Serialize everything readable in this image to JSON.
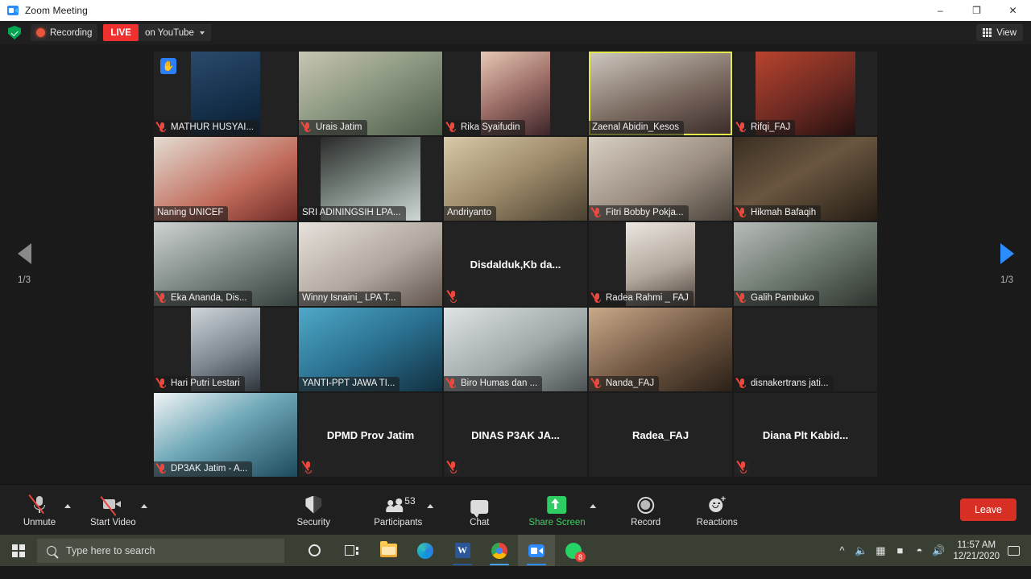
{
  "window": {
    "title": "Zoom Meeting",
    "app_icon": "zoom-icon",
    "minimize": "–",
    "maximize": "❐",
    "close": "✕"
  },
  "topbar": {
    "shield_icon": "shield-encryption-icon",
    "recording_label": "Recording",
    "live_label": "LIVE",
    "stream_label": "on YouTube",
    "stream_caret_icon": "chevron-down-icon",
    "view_label": "View",
    "view_icon": "grid-icon"
  },
  "gallery": {
    "page_left_icon": "chevron-left-icon",
    "page_right_icon": "chevron-right-icon",
    "page_indicator_left": "1/3",
    "page_indicator_right": "1/3",
    "tiles": [
      {
        "name": "MATHUR HUSYAI...",
        "muted": true,
        "video": true,
        "active": false,
        "raise_hand": true,
        "layout": "narrow",
        "label": "bottom"
      },
      {
        "name": "Urais Jatim",
        "muted": true,
        "video": true,
        "active": false,
        "raise_hand": false,
        "layout": "full",
        "label": "bottom"
      },
      {
        "name": "Rika Syaifudin",
        "muted": true,
        "video": true,
        "active": false,
        "raise_hand": false,
        "layout": "narrow",
        "label": "bottom"
      },
      {
        "name": "Zaenal Abidin_Kesos",
        "muted": false,
        "video": true,
        "active": true,
        "raise_hand": false,
        "layout": "full",
        "label": "bottom"
      },
      {
        "name": "Rifqi_FAJ",
        "muted": true,
        "video": true,
        "active": false,
        "raise_hand": false,
        "layout": "mid",
        "label": "bottom"
      },
      {
        "name": "Naning UNICEF",
        "muted": false,
        "video": true,
        "active": false,
        "raise_hand": false,
        "layout": "full",
        "label": "bottom"
      },
      {
        "name": "SRI ADININGSIH LPA...",
        "muted": false,
        "video": true,
        "active": false,
        "raise_hand": false,
        "layout": "mid",
        "label": "bottom"
      },
      {
        "name": "Andriyanto",
        "muted": false,
        "video": true,
        "active": false,
        "raise_hand": false,
        "layout": "full",
        "label": "bottom"
      },
      {
        "name": "Fitri Bobby Pokja...",
        "muted": true,
        "video": true,
        "active": false,
        "raise_hand": false,
        "layout": "full",
        "label": "bottom"
      },
      {
        "name": "Hikmah Bafaqih",
        "muted": true,
        "video": true,
        "active": false,
        "raise_hand": false,
        "layout": "full",
        "label": "bottom"
      },
      {
        "name": "Eka Ananda, Dis...",
        "muted": true,
        "video": true,
        "active": false,
        "raise_hand": false,
        "layout": "full",
        "label": "bottom"
      },
      {
        "name": "Winny Isnaini_ LPA T...",
        "muted": false,
        "video": true,
        "active": false,
        "raise_hand": false,
        "layout": "full",
        "label": "bottom"
      },
      {
        "name": "Disdalduk,Kb  da...",
        "muted": true,
        "video": false,
        "active": false,
        "raise_hand": false,
        "layout": "none",
        "label": "center"
      },
      {
        "name": "Radea Rahmi _ FAJ",
        "muted": true,
        "video": true,
        "active": false,
        "raise_hand": false,
        "layout": "narrow",
        "label": "bottom"
      },
      {
        "name": "Galih Pambuko",
        "muted": true,
        "video": true,
        "active": false,
        "raise_hand": false,
        "layout": "full",
        "label": "bottom"
      },
      {
        "name": "Hari Putri Lestari",
        "muted": true,
        "video": true,
        "active": false,
        "raise_hand": false,
        "layout": "narrow",
        "label": "bottom"
      },
      {
        "name": "YANTI-PPT JAWA TI...",
        "muted": false,
        "video": true,
        "active": false,
        "raise_hand": false,
        "layout": "full",
        "label": "bottom"
      },
      {
        "name": "Biro Humas dan ...",
        "muted": true,
        "video": true,
        "active": false,
        "raise_hand": false,
        "layout": "full",
        "label": "bottom"
      },
      {
        "name": "Nanda_FAJ",
        "muted": true,
        "video": true,
        "active": false,
        "raise_hand": false,
        "layout": "full",
        "label": "bottom"
      },
      {
        "name": "disnakertrans jati...",
        "muted": true,
        "video": false,
        "active": false,
        "raise_hand": false,
        "layout": "none",
        "label": "bottom"
      },
      {
        "name": "DP3AK Jatim - A...",
        "muted": true,
        "video": true,
        "active": false,
        "raise_hand": false,
        "layout": "full",
        "label": "bottom"
      },
      {
        "name": "DPMD Prov Jatim",
        "muted": true,
        "video": false,
        "active": false,
        "raise_hand": false,
        "layout": "none",
        "label": "center"
      },
      {
        "name": "DINAS P3AK JA...",
        "muted": true,
        "video": false,
        "active": false,
        "raise_hand": false,
        "layout": "none",
        "label": "center"
      },
      {
        "name": "Radea_FAJ",
        "muted": false,
        "video": false,
        "active": false,
        "raise_hand": false,
        "layout": "none",
        "label": "center"
      },
      {
        "name": "Diana  Plt  Kabid...",
        "muted": true,
        "video": false,
        "active": false,
        "raise_hand": false,
        "layout": "none",
        "label": "center"
      }
    ]
  },
  "toolbar": {
    "unmute_label": "Unmute",
    "unmute_icon": "mic-muted-icon",
    "start_video_label": "Start Video",
    "start_video_icon": "camera-off-icon",
    "security_label": "Security",
    "security_icon": "shield-icon",
    "participants_label": "Participants",
    "participants_icon": "people-icon",
    "participants_count": "53",
    "chat_label": "Chat",
    "chat_icon": "chat-bubble-icon",
    "share_screen_label": "Share Screen",
    "share_screen_icon": "share-screen-icon",
    "record_label": "Record",
    "record_icon": "record-circle-icon",
    "reactions_label": "Reactions",
    "reactions_icon": "smiley-reaction-icon",
    "leave_label": "Leave",
    "caret_icon": "chevron-up-icon"
  },
  "taskbar": {
    "start_icon": "windows-logo-icon",
    "search_placeholder": "Type here to search",
    "search_icon": "search-icon",
    "apps": [
      {
        "icon": "cortana-icon",
        "name": "cortana"
      },
      {
        "icon": "task-view-icon",
        "name": "task-view"
      },
      {
        "icon": "file-explorer-icon",
        "name": "file-explorer"
      },
      {
        "icon": "edge-icon",
        "name": "microsoft-edge"
      },
      {
        "icon": "word-icon",
        "name": "microsoft-word"
      },
      {
        "icon": "chrome-icon",
        "name": "google-chrome"
      },
      {
        "icon": "zoom-icon",
        "name": "zoom"
      },
      {
        "icon": "whatsapp-icon",
        "name": "whatsapp",
        "badge": "8"
      }
    ],
    "tray": {
      "expand_icon": "chevron-up-icon",
      "mic_icon": "microphone-icon",
      "display_icon": "display-icon",
      "battery_icon": "battery-icon",
      "wifi_icon": "wifi-icon",
      "volume_icon": "volume-icon",
      "time": "11:57 AM",
      "date": "12/21/2020",
      "notifications_icon": "notification-icon"
    }
  },
  "colors": {
    "live_red": "#f0302f",
    "active_speaker": "#e3e84b",
    "share_green": "#2ecc62",
    "leave_red": "#d93025",
    "pager_active": "#2d8cff",
    "mute_red": "#e84a3f"
  }
}
